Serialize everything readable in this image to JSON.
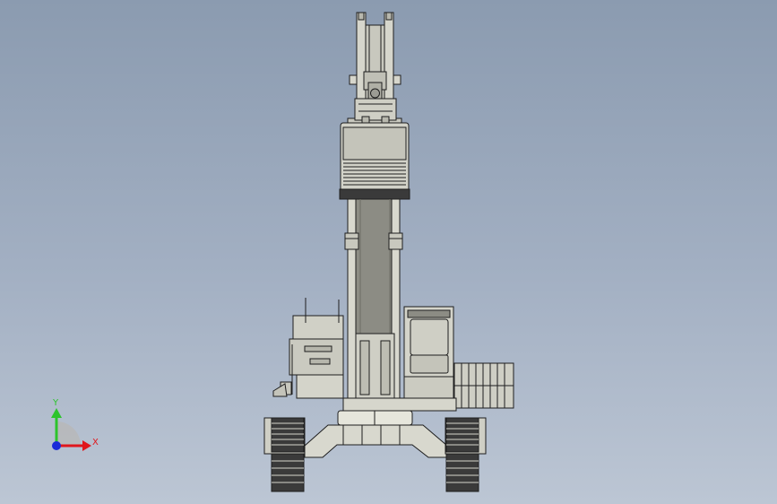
{
  "viewport": {
    "background_top": "#8b9bb0",
    "background_bottom": "#bcc6d4"
  },
  "triad": {
    "x_label": "X",
    "y_label": "Y",
    "x_color": "#e0161c",
    "y_color": "#2cc42c",
    "z_color": "#1a2bd8"
  },
  "model": {
    "subject": "excavator",
    "view": "front",
    "body_color": "#d6d6cc",
    "edge_color": "#1e1e1e",
    "shadow_color": "#8c8c84",
    "dark_color": "#3a3a3a"
  }
}
